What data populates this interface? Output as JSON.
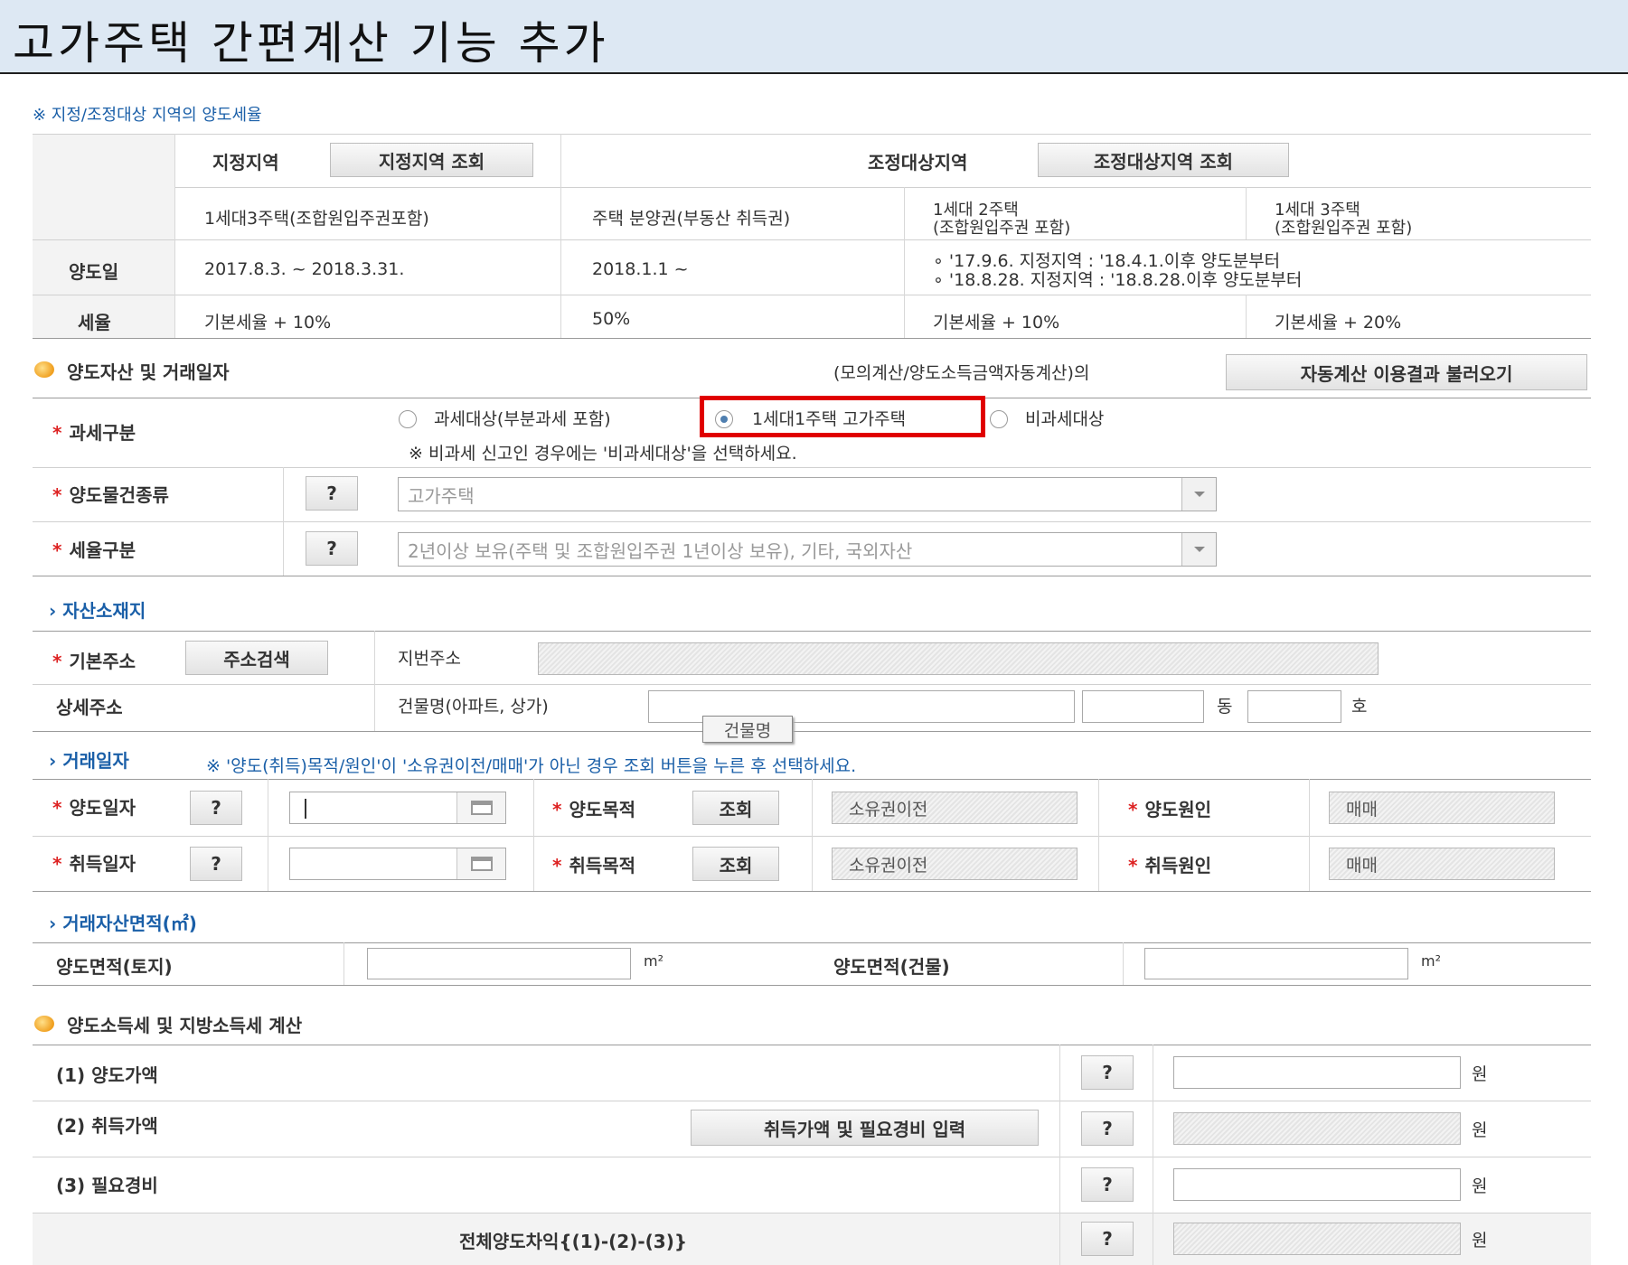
{
  "header": {
    "title": "고가주택 간편계산 기능 추가"
  },
  "rate_table": {
    "note": "※ 지정/조정대상 지역의 양도세율",
    "designated_label": "지정지역",
    "designated_button": "지정지역 조회",
    "adjusted_label": "조정대상지역",
    "adjusted_button": "조정대상지역 조회",
    "columns": [
      "1세대3주택(조합원입주권포함)",
      "주택 분양권(부동산 취득권)",
      "1세대 2주택",
      "(조합원입주권 포함)",
      "1세대 3주택",
      "(조합원입주권 포함)"
    ],
    "transfer_date_label": "양도일",
    "transfer_dates": [
      "2017.8.3. ~ 2018.3.31.",
      "2018.1.1 ~",
      "∘ '17.9.6. 지정지역 : '18.4.1.이후 양도분부터",
      "∘ '18.8.28. 지정지역 : '18.8.28.이후 양도분부터"
    ],
    "rate_label": "세율",
    "rates": [
      "기본세율 + 10%",
      "50%",
      "기본세율 + 10%",
      "기본세율 + 20%"
    ]
  },
  "asset_section": {
    "title": "양도자산 및 거래일자",
    "auto_calc_text": "(모의계산/양도소득금액자동계산)의",
    "auto_calc_button": "자동계산 이용결과 불러오기",
    "tax_type_label": "과세구분",
    "options": [
      "과세대상(부분과세 포함)",
      "1세대1주택 고가주택",
      "비과세대상"
    ],
    "tax_note": "※ 비과세 신고인 경우에는 '비과세대상'을 선택하세요.",
    "asset_kind_label": "양도물건종류",
    "asset_kind_value": "고가주택",
    "rate_type_label": "세율구분",
    "rate_type_value": "2년이상 보유(주택 및 조합원입주권 1년이상 보유), 기타, 국외자산",
    "help": "?"
  },
  "location_section": {
    "title": "자산소재지",
    "basic_address_label": "기본주소",
    "address_search_button": "주소검색",
    "lot_address_label": "지번주소",
    "detail_address_label": "상세주소",
    "building_label": "건물명(아파트, 상가)",
    "building_tooltip": "건물명",
    "dong": "동",
    "ho": "호"
  },
  "trade_section": {
    "title": "거래일자",
    "note": "※ '양도(취득)목적/원인'이 '소유권이전/매매'가 아닌 경우 조회 버튼을 누른 후 선택하세요.",
    "transfer_date_label": "양도일자",
    "acquire_date_label": "취득일자",
    "transfer_purpose_label": "양도목적",
    "acquire_purpose_label": "취득목적",
    "lookup_button": "조회",
    "purpose_value": "소유권이전",
    "transfer_cause_label": "양도원인",
    "acquire_cause_label": "취득원인",
    "cause_value": "매매"
  },
  "area_section": {
    "title": "거래자산면적(㎡)",
    "land_label": "양도면적(토지)",
    "building_label": "양도면적(건물)",
    "unit": "m²"
  },
  "calc_section": {
    "title": "양도소득세 및 지방소득세 계산",
    "items": [
      "(1) 양도가액",
      "(2) 취득가액",
      "(3) 필요경비",
      "전체양도차익{(1)-(2)-(3)}"
    ],
    "acquire_cost_button": "취득가액 및 필요경비 입력",
    "unit": "원"
  }
}
